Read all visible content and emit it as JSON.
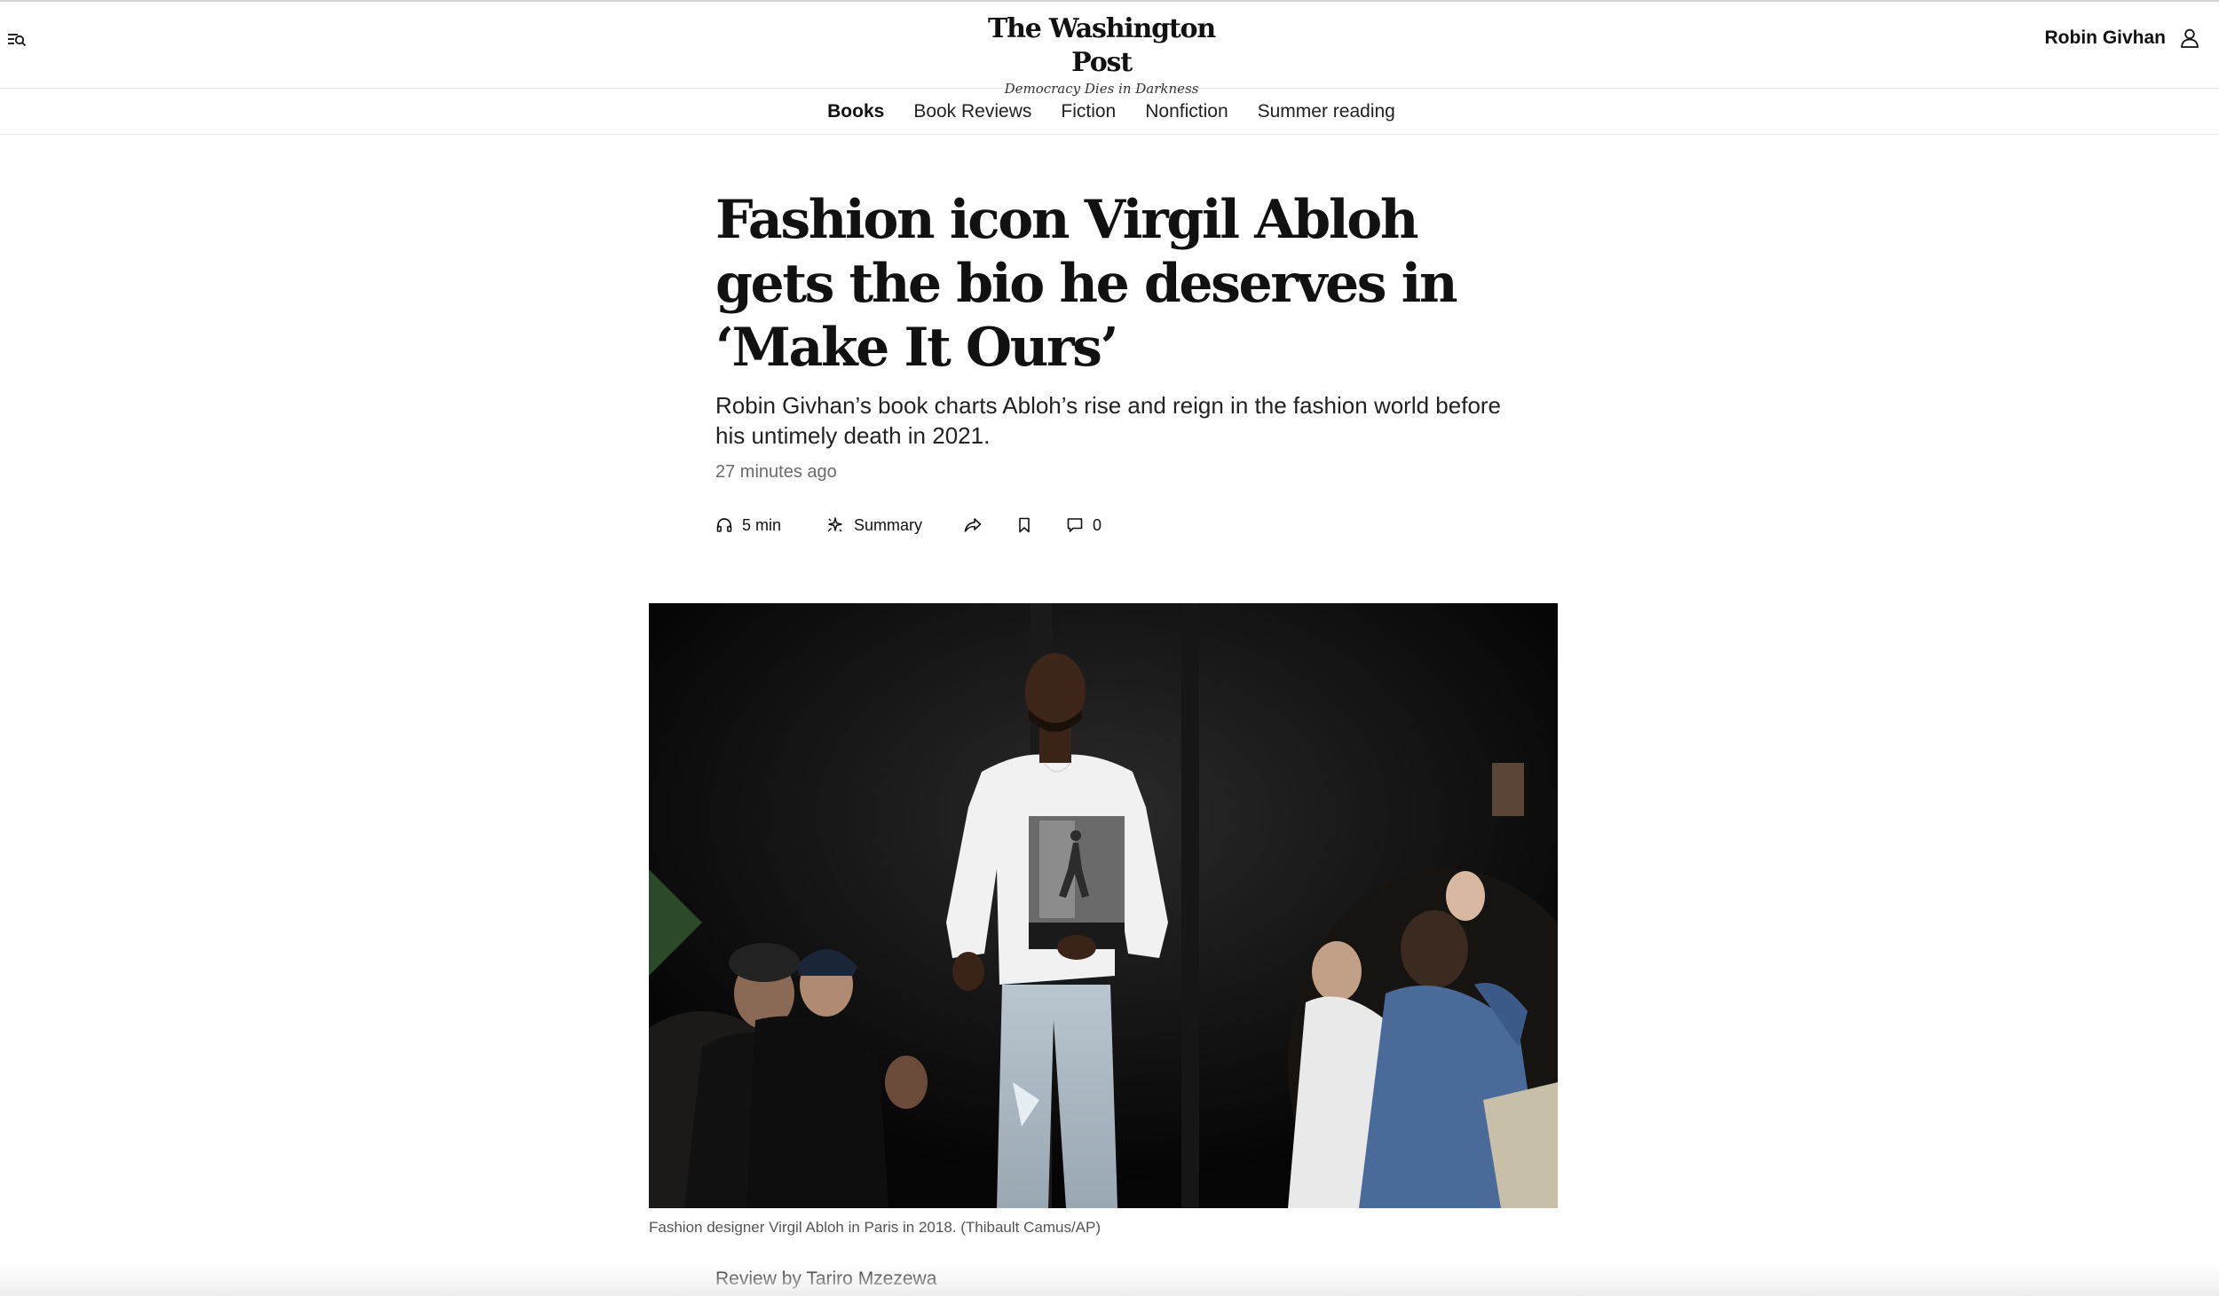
{
  "header": {
    "logo_name": "The Washington Post",
    "logo_tagline": "Democracy Dies in Darkness",
    "user_name": "Robin Givhan",
    "menu_icon": "menu-search-icon",
    "user_icon": "user-icon"
  },
  "section_nav": {
    "items": [
      {
        "label": "Books",
        "active": true
      },
      {
        "label": "Book Reviews",
        "active": false
      },
      {
        "label": "Fiction",
        "active": false
      },
      {
        "label": "Nonfiction",
        "active": false
      },
      {
        "label": "Summer reading",
        "active": false
      }
    ]
  },
  "article": {
    "headline": "Fashion icon Virgil Abloh gets the bio he deserves in ‘Make It Ours’",
    "dek": "Robin Givhan’s book charts Abloh’s rise and reign in the fashion world before his untimely death in 2021.",
    "timestamp": "27 minutes ago",
    "actions": {
      "listen_label": "5 min",
      "summary_label": "Summary",
      "comments_count": "0"
    },
    "photo": {
      "caption": "Fashion designer Virgil Abloh in Paris in 2018.",
      "credit": "(Thibault Camus/AP)"
    },
    "byline_prefix": "Review by",
    "byline_author": "Tariro Mzezewa"
  }
}
